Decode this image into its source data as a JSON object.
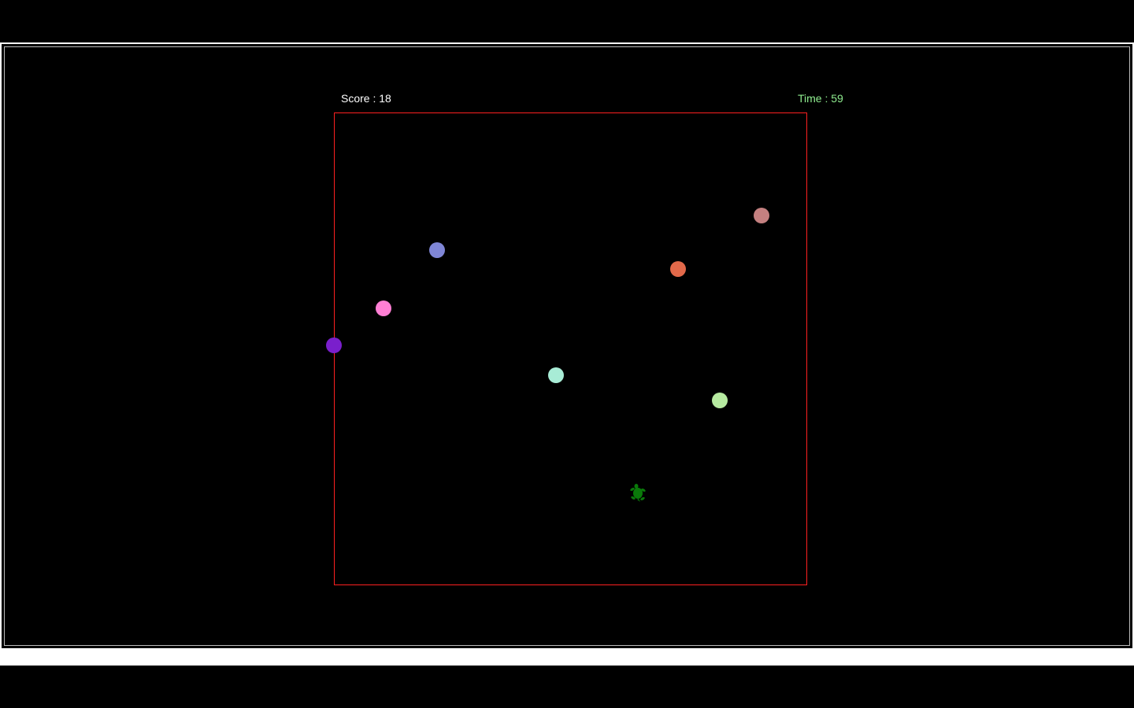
{
  "hud": {
    "score_text": "Score : 18",
    "time_text": "Time : 59",
    "score_color": "#ffffff",
    "time_color": "#90ee90"
  },
  "arena": {
    "border_color": "#ff2020"
  },
  "player": {
    "icon": "turtle-icon",
    "color": "#0a7a0a"
  },
  "balls": [
    {
      "name": "ball-rosybrown",
      "color": "#c48080"
    },
    {
      "name": "ball-slateblue",
      "color": "#7f86d6"
    },
    {
      "name": "ball-coral",
      "color": "#e2694a"
    },
    {
      "name": "ball-hotpink",
      "color": "#ff7fd4"
    },
    {
      "name": "ball-purple",
      "color": "#7a1fcc"
    },
    {
      "name": "ball-aquamarine",
      "color": "#a8ecd6"
    },
    {
      "name": "ball-palegreen",
      "color": "#b6eaa0"
    }
  ]
}
